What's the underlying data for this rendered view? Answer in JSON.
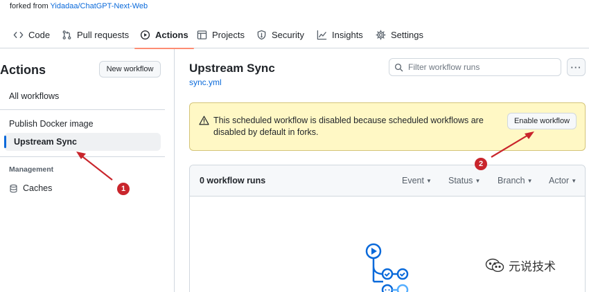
{
  "repo": {
    "forked_prefix": "forked from",
    "forked_link": "Yidadaa/ChatGPT-Next-Web"
  },
  "tabs": [
    {
      "label": "Code",
      "icon": "code-icon"
    },
    {
      "label": "Pull requests",
      "icon": "pull-request-icon"
    },
    {
      "label": "Actions",
      "icon": "play-icon",
      "active": true
    },
    {
      "label": "Projects",
      "icon": "table-icon"
    },
    {
      "label": "Security",
      "icon": "shield-icon"
    },
    {
      "label": "Insights",
      "icon": "graph-icon"
    },
    {
      "label": "Settings",
      "icon": "gear-icon"
    }
  ],
  "sidebar": {
    "title": "Actions",
    "new_workflow_label": "New workflow",
    "all_workflows": "All workflows",
    "workflows": [
      "Publish Docker image",
      "Upstream Sync"
    ],
    "selected_workflow": "Upstream Sync",
    "management_heading": "Management",
    "caches_label": "Caches"
  },
  "main": {
    "title": "Upstream Sync",
    "file": "sync.yml",
    "filter_placeholder": "Filter workflow runs",
    "kebab": "···"
  },
  "banner": {
    "text": "This scheduled workflow is disabled because scheduled workflows are disabled by default in forks.",
    "enable_label": "Enable workflow"
  },
  "runs": {
    "count_label": "0 workflow runs",
    "filters": [
      "Event",
      "Status",
      "Branch",
      "Actor"
    ]
  },
  "annotations": {
    "badge_1": "1",
    "badge_2": "2",
    "arrow_color": "#c9252c"
  },
  "watermark": {
    "text": "元说技术"
  },
  "colors": {
    "link": "#0969da",
    "active_tab_underline": "#fd8c73",
    "banner_bg": "#fff8c5",
    "border": "#d0d7de"
  }
}
